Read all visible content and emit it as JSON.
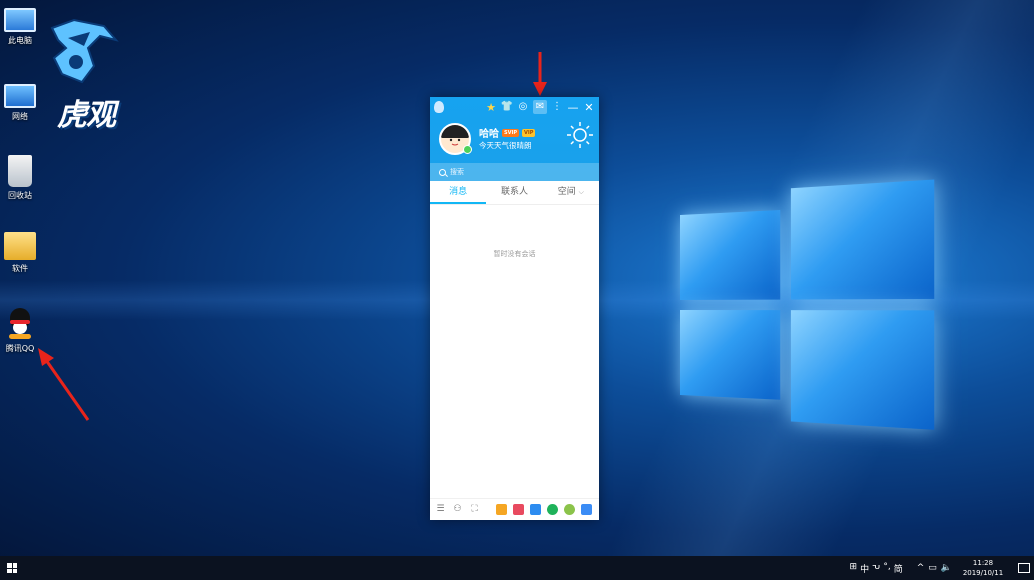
{
  "desktop": {
    "brand_text": "虎观",
    "icons": [
      {
        "label": "此电脑",
        "icon": "computer-icon"
      },
      {
        "label": "网络",
        "icon": "network-icon"
      },
      {
        "label": "回收站",
        "icon": "recycle-bin-icon"
      },
      {
        "label": "软件",
        "icon": "folder-icon"
      },
      {
        "label": "腾讯QQ",
        "icon": "qq-penguin-icon"
      }
    ]
  },
  "qq": {
    "nickname": "哈哈",
    "badges": {
      "svip": "SVIP",
      "vip": "VIP"
    },
    "signature": "今天天气很晴朗",
    "search_placeholder": "搜索",
    "tabs": [
      {
        "label": "消息",
        "active": true
      },
      {
        "label": "联系人",
        "active": false
      },
      {
        "label": "空间",
        "active": false
      }
    ],
    "empty_text": "暂时没有会话",
    "accent_color": "#12b7f5"
  },
  "taskbar": {
    "ime": [
      "中",
      "ᕃ",
      "°,",
      "简"
    ],
    "time": "11:28",
    "date": "2019/10/11"
  },
  "colors": {
    "arrow": "#e8241b",
    "header_blue": "#16a3f0"
  }
}
